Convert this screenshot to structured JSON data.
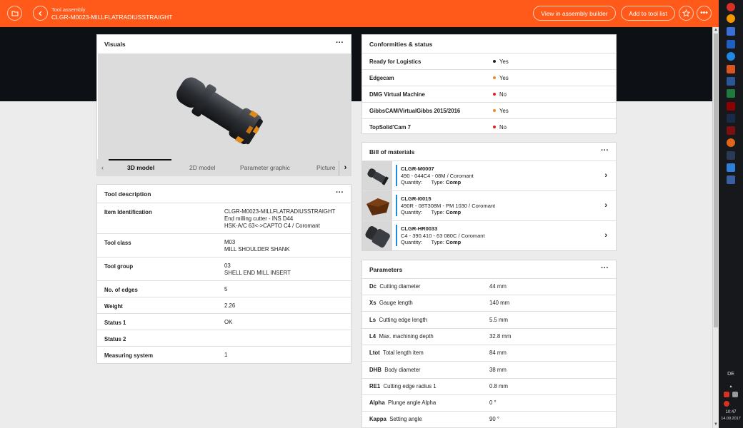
{
  "header": {
    "subtitle": "Tool assembly",
    "title": "CLGR-M0023-MILLFLATRADIUSSTRAIGHT",
    "view_builder_label": "View in assembly builder",
    "add_tool_label": "Add to tool list"
  },
  "visuals": {
    "title": "Visuals",
    "tabs": [
      "3D model",
      "2D model",
      "Parameter graphic",
      "Picture"
    ],
    "active_tab": "3D model"
  },
  "description": {
    "title": "Tool description",
    "rows": [
      {
        "label": "Item Identification",
        "lines": [
          "CLGR-M0023-MILLFLATRADIUSSTRAIGHT",
          "End milling cutter - INS D44",
          "HSK-A/C 63<->CAPTO C4 / Coromant"
        ]
      },
      {
        "label": "Tool class",
        "lines": [
          "M03",
          "MILL SHOULDER SHANK"
        ]
      },
      {
        "label": "Tool group",
        "lines": [
          "03",
          "SHELL END MILL INSERT"
        ]
      },
      {
        "label": "No. of edges",
        "lines": [
          "5"
        ]
      },
      {
        "label": "Weight",
        "lines": [
          "2.26"
        ]
      },
      {
        "label": "Status 1",
        "lines": [
          "OK"
        ]
      },
      {
        "label": "Status 2",
        "lines": [
          ""
        ]
      },
      {
        "label": "Measuring system",
        "lines": [
          "1"
        ]
      }
    ]
  },
  "conformities": {
    "title": "Conformities & status",
    "rows": [
      {
        "label": "Ready for Logistics",
        "value": "Yes",
        "color": "#222222"
      },
      {
        "label": "Edgecam",
        "value": "Yes",
        "color": "#f08a24"
      },
      {
        "label": "DMG Virtual Machine",
        "value": "No",
        "color": "#e02020"
      },
      {
        "label": "GibbsCAM/VirtualGibbs 2015/2016",
        "value": "Yes",
        "color": "#f08a24"
      },
      {
        "label": "TopSolid'Cam 7",
        "value": "No",
        "color": "#e02020"
      }
    ]
  },
  "bom": {
    "title": "Bill of materials",
    "quantity_label": "Quantity:",
    "type_label": "Type:",
    "items": [
      {
        "id": "CLGR-M0007",
        "desc": "490 - 044C4 - 08M / Coromant",
        "type": "Comp"
      },
      {
        "id": "CLGR-I0015",
        "desc": "490R - 08T308M - PM 1030 / Coromant",
        "type": "Comp"
      },
      {
        "id": "CLGR-HR0033",
        "desc": "C4 - 390.410 - 63 080C / Coromant",
        "type": "Comp"
      }
    ]
  },
  "parameters": {
    "title": "Parameters",
    "rows": [
      {
        "code": "Dc",
        "name": "Cutting diameter",
        "value": "44 mm"
      },
      {
        "code": "Xs",
        "name": "Gauge length",
        "value": "140 mm"
      },
      {
        "code": "Ls",
        "name": "Cutting edge length",
        "value": "5.5 mm"
      },
      {
        "code": "L4",
        "name": "Max. machining depth",
        "value": "32.8 mm"
      },
      {
        "code": "Ltot",
        "name": "Total length item",
        "value": "84 mm"
      },
      {
        "code": "DHB",
        "name": "Body diameter",
        "value": "38 mm"
      },
      {
        "code": "RE1",
        "name": "Cutting edge radius 1",
        "value": "0.8 mm"
      },
      {
        "code": "Alpha",
        "name": "Plunge angle Alpha",
        "value": "0 °"
      },
      {
        "code": "Kappa",
        "name": "Setting angle",
        "value": "90 °"
      }
    ]
  },
  "taskbar": {
    "language": "DE",
    "time": "10:47",
    "date": "14.09.2017"
  }
}
